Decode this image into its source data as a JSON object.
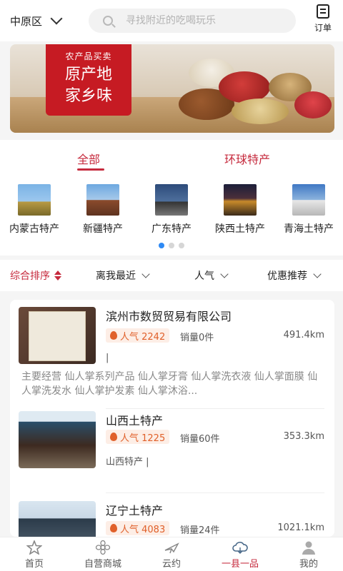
{
  "header": {
    "location": "中原区",
    "search_placeholder": "寻找附近的吃喝玩乐",
    "orders_label": "订单"
  },
  "banner": {
    "badge_small": "农产品买卖",
    "badge_line1": "原产地",
    "badge_line2": "家乡味"
  },
  "tabs": [
    {
      "label": "全部"
    },
    {
      "label": "环球特产"
    }
  ],
  "categories": [
    {
      "label": "内蒙古特产"
    },
    {
      "label": "新疆特产"
    },
    {
      "label": "广东特产"
    },
    {
      "label": "陕西土特产"
    },
    {
      "label": "青海土特产"
    }
  ],
  "filters": [
    {
      "label": "综合排序"
    },
    {
      "label": "离我最近"
    },
    {
      "label": "人气"
    },
    {
      "label": "优惠推荐"
    }
  ],
  "stores": [
    {
      "name": "滨州市数贸贸易有限公司",
      "popularity": "人气 2242",
      "sales": "销量0件",
      "distance": "491.4km",
      "tag": "|",
      "scope": "主要经营  仙人掌系列产品  仙人掌牙膏  仙人掌洗衣液  仙人掌面膜  仙人掌洗发水  仙人掌护发素  仙人掌沐浴..."
    },
    {
      "name": "山西土特产",
      "popularity": "人气 1225",
      "sales": "销量60件",
      "distance": "353.3km",
      "tag": "山西特产 |"
    },
    {
      "name": "辽宁土特产",
      "popularity": "人气 4083",
      "sales": "销量24件",
      "distance": "1021.1km"
    }
  ],
  "bottom_nav": [
    {
      "label": "首页",
      "icon": "star-icon"
    },
    {
      "label": "自营商城",
      "icon": "flower-icon"
    },
    {
      "label": "云约",
      "icon": "plane-icon"
    },
    {
      "label": "一县一品",
      "icon": "cloud-icon"
    },
    {
      "label": "我的",
      "icon": "person-icon"
    }
  ],
  "colors": {
    "accent": "#c62a3d",
    "popularity": "#e0602a",
    "active_dot": "#2f8af4"
  }
}
